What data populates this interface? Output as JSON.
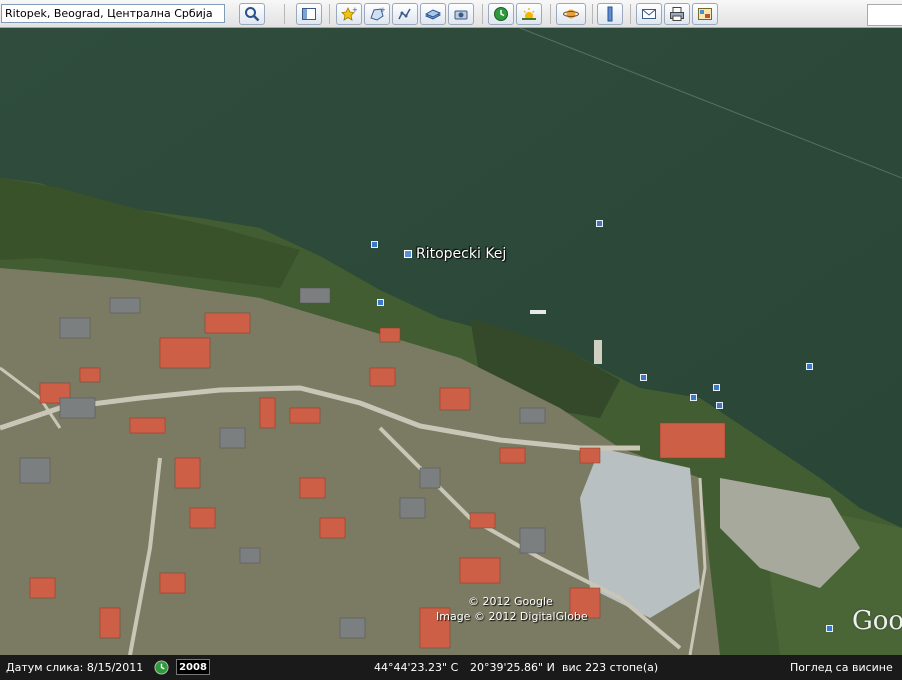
{
  "search": {
    "value": "Ritopek, Beograd, Централна Србија"
  },
  "map": {
    "place_label": "Ritopecki Kej",
    "credit_1": "© 2012 Google",
    "credit_2": "Image © 2012 DigitalGlobe",
    "logo_text": "Goo"
  },
  "status": {
    "image_date_label": "Датум слика: 8/15/2011",
    "year": "2008",
    "lat": "44°44'23.23\" С",
    "lon": "20°39'25.86\" И",
    "elevation": "вис   223 стопе(а)",
    "eye_alt_label": "Поглед са висине"
  },
  "colors": {
    "water": "#2e4b3b",
    "vegetation": "#3f5a2e",
    "roof": "#d4664a",
    "pin": "#3a78c9"
  }
}
